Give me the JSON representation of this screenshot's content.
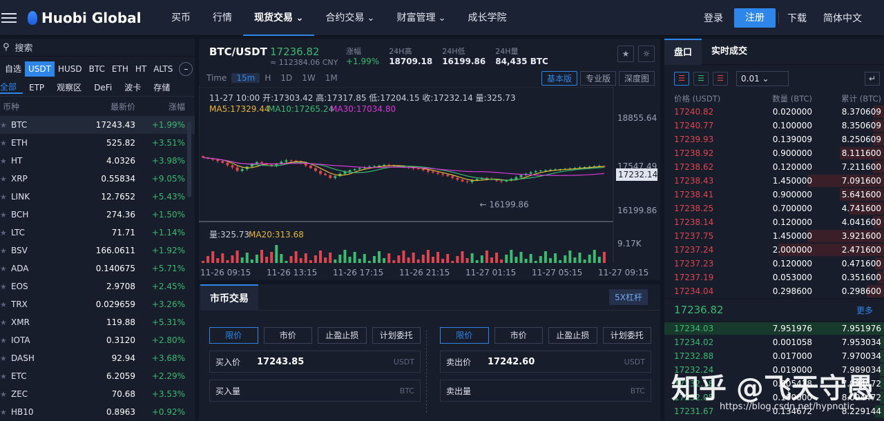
{
  "topbar": {
    "logo": "Huobi Global",
    "nav": [
      "买币",
      "行情",
      "现货交易",
      "合约交易",
      "财富管理",
      "成长学院"
    ],
    "login": "登录",
    "register": "注册",
    "download": "下载",
    "language": "简体中文"
  },
  "sidebar": {
    "search_placeholder": "搜索",
    "market_tabs": [
      "自选",
      "USDT",
      "HUSD",
      "BTC",
      "ETH",
      "HT",
      "ALTS"
    ],
    "active_market": "USDT",
    "sub_tabs": [
      "全部",
      "ETP",
      "观察区",
      "DeFi",
      "波卡",
      "存储"
    ],
    "col_headers": [
      "币种",
      "最新价",
      "涨幅"
    ],
    "coins": [
      {
        "name": "BTC",
        "price": "17243.43",
        "change": "+1.99%"
      },
      {
        "name": "ETH",
        "price": "525.82",
        "change": "+3.51%"
      },
      {
        "name": "HT",
        "price": "4.0326",
        "change": "+3.98%"
      },
      {
        "name": "XRP",
        "price": "0.55834",
        "change": "+9.05%"
      },
      {
        "name": "LINK",
        "price": "12.7652",
        "change": "+5.43%"
      },
      {
        "name": "BCH",
        "price": "274.36",
        "change": "+1.50%"
      },
      {
        "name": "LTC",
        "price": "71.71",
        "change": "+1.14%"
      },
      {
        "name": "BSV",
        "price": "166.0611",
        "change": "+1.92%"
      },
      {
        "name": "ADA",
        "price": "0.140675",
        "change": "+5.71%"
      },
      {
        "name": "EOS",
        "price": "2.9708",
        "change": "+2.45%"
      },
      {
        "name": "TRX",
        "price": "0.029659",
        "change": "+3.26%"
      },
      {
        "name": "XMR",
        "price": "119.88",
        "change": "+5.31%"
      },
      {
        "name": "IOTA",
        "price": "0.3120",
        "change": "+2.80%"
      },
      {
        "name": "DASH",
        "price": "92.94",
        "change": "+3.68%"
      },
      {
        "name": "ETC",
        "price": "6.2059",
        "change": "+2.29%"
      },
      {
        "name": "ZEC",
        "price": "70.68",
        "change": "+3.53%"
      },
      {
        "name": "HB10",
        "price": "0.8963",
        "change": "+0.92%"
      }
    ]
  },
  "pair": {
    "symbol": "BTC/USDT",
    "price": "17236.82",
    "cny": "≈ 112384.06 CNY",
    "stats": [
      {
        "label": "涨幅",
        "value": "+1.99%"
      },
      {
        "label": "24H高",
        "value": "18709.18"
      },
      {
        "label": "24H低",
        "value": "16199.86"
      },
      {
        "label": "24H量",
        "value": "84,435 BTC"
      }
    ]
  },
  "chart_toolbar": {
    "time_label": "Time",
    "interval": "15m",
    "intervals": [
      "H",
      "1D",
      "1W",
      "1M"
    ],
    "views": [
      "基本版",
      "专业版",
      "深度图"
    ]
  },
  "chart_data": {
    "type": "candlestick",
    "ohlc_label": "11-27 10:00  开:17303.42 高:17317.85 低:17204.15 收:17232.14 量:325.73",
    "ma_labels": [
      {
        "text": "MA5:17329.44",
        "color": "#e8b73a"
      },
      {
        "text": "MA10:17265.24",
        "color": "#3cba70"
      },
      {
        "text": "MA30:17034.80",
        "color": "#d63ad6"
      }
    ],
    "y_ticks": [
      "18855.64",
      "17547.49",
      "16199.86"
    ],
    "current_price": "17232.14",
    "low_marker": "16199.86",
    "volume_label": "量:325.73",
    "volume_ma": "MA20:313.68",
    "volume_tick": "9.17K",
    "x_ticks": [
      "11-26 09:15",
      "11-26 13:15",
      "11-26 17:15",
      "11-26 21:15",
      "11-27 01:15",
      "11-27 05:15",
      "11-27 09:15"
    ],
    "closes": [
      17480,
      17450,
      17420,
      17380,
      17330,
      17260,
      17200,
      17100,
      17150,
      17220,
      17300,
      17350,
      17320,
      17280,
      17250,
      17300,
      17360,
      17400,
      17390,
      17360,
      17320,
      17250,
      17180,
      17100,
      17020,
      16980,
      16900,
      16950,
      17020,
      17080,
      17120,
      17150,
      17180,
      17200,
      17220,
      17240,
      17250,
      17270,
      17260,
      17240,
      17230,
      17210,
      17190,
      17170,
      17150,
      17120,
      17080,
      17050,
      17020,
      16990,
      16950,
      16900,
      16850,
      16800,
      16780,
      16830,
      16870,
      16900,
      16880,
      16850,
      16820,
      16800,
      16830,
      16870,
      16920,
      16980,
      17020,
      17060,
      17090,
      17110,
      17120,
      17130,
      17140,
      17150,
      17160,
      17170,
      17180,
      17200,
      17210,
      17220,
      17230,
      17240,
      17232
    ]
  },
  "trade": {
    "tab": "市币交易",
    "leverage": "5X杠杆",
    "order_types": [
      "限价",
      "市价",
      "止盈止损",
      "计划委托"
    ],
    "buy": {
      "price_label": "买入价",
      "price": "17243.85",
      "price_unit": "USDT",
      "qty_label": "买入量",
      "qty_unit": "BTC"
    },
    "sell": {
      "price_label": "卖出价",
      "price": "17242.60",
      "price_unit": "USDT",
      "qty_label": "卖出量",
      "qty_unit": "BTC"
    }
  },
  "orderbook": {
    "tabs": [
      "盘口",
      "实时成交"
    ],
    "precision": "0.01",
    "headers": [
      "价格 (USDT)",
      "数量 (BTC)",
      "累计 (BTC)"
    ],
    "asks": [
      {
        "price": "17240.82",
        "qty": "0.020000",
        "sum": "8.370609",
        "depth": 0.05
      },
      {
        "price": "17240.77",
        "qty": "0.100000",
        "sum": "8.350609",
        "depth": 0.05
      },
      {
        "price": "17239.93",
        "qty": "0.139009",
        "sum": "8.250609",
        "depth": 0.05
      },
      {
        "price": "17238.92",
        "qty": "0.900000",
        "sum": "8.111600",
        "depth": 0.2
      },
      {
        "price": "17238.62",
        "qty": "0.120000",
        "sum": "7.211600",
        "depth": 0.05
      },
      {
        "price": "17238.43",
        "qty": "1.450000",
        "sum": "7.091600",
        "depth": 0.35
      },
      {
        "price": "17238.41",
        "qty": "0.900000",
        "sum": "5.641600",
        "depth": 0.2
      },
      {
        "price": "17238.25",
        "qty": "0.700000",
        "sum": "4.741600",
        "depth": 0.16
      },
      {
        "price": "17238.14",
        "qty": "0.120000",
        "sum": "4.041600",
        "depth": 0.05
      },
      {
        "price": "17237.75",
        "qty": "1.450000",
        "sum": "3.921600",
        "depth": 0.35
      },
      {
        "price": "17237.24",
        "qty": "2.000000",
        "sum": "2.471600",
        "depth": 0.48
      },
      {
        "price": "17237.23",
        "qty": "0.120000",
        "sum": "0.471600",
        "depth": 0.04
      },
      {
        "price": "17237.19",
        "qty": "0.053000",
        "sum": "0.351600",
        "depth": 0.03
      },
      {
        "price": "17234.04",
        "qty": "0.298600",
        "sum": "0.298600",
        "depth": 0.08
      }
    ],
    "last_price": "17236.82",
    "more": "更多",
    "bids": [
      {
        "price": "17234.03",
        "qty": "7.951976",
        "sum": "7.951976",
        "depth": 1.0
      },
      {
        "price": "17234.02",
        "qty": "0.001058",
        "sum": "7.953034",
        "depth": 0.02
      },
      {
        "price": "17232.88",
        "qty": "0.017000",
        "sum": "7.970034",
        "depth": 0.02
      },
      {
        "price": "17232.24",
        "qty": "0.019000",
        "sum": "7.989034",
        "depth": 0.02
      },
      {
        "price": "17232.18",
        "qty": "0.005438",
        "sum": "7.994472",
        "depth": 0.02
      },
      {
        "price": "17232.05",
        "qty": "0.100000",
        "sum": "8.094472",
        "depth": 0.02
      },
      {
        "price": "17231.67",
        "qty": "0.134672",
        "sum": "8.229144",
        "depth": 0.04
      }
    ]
  },
  "watermark": {
    "main": "知乎 @飞天守愚",
    "url": "https://blog.csdn.net/hypnotic"
  }
}
